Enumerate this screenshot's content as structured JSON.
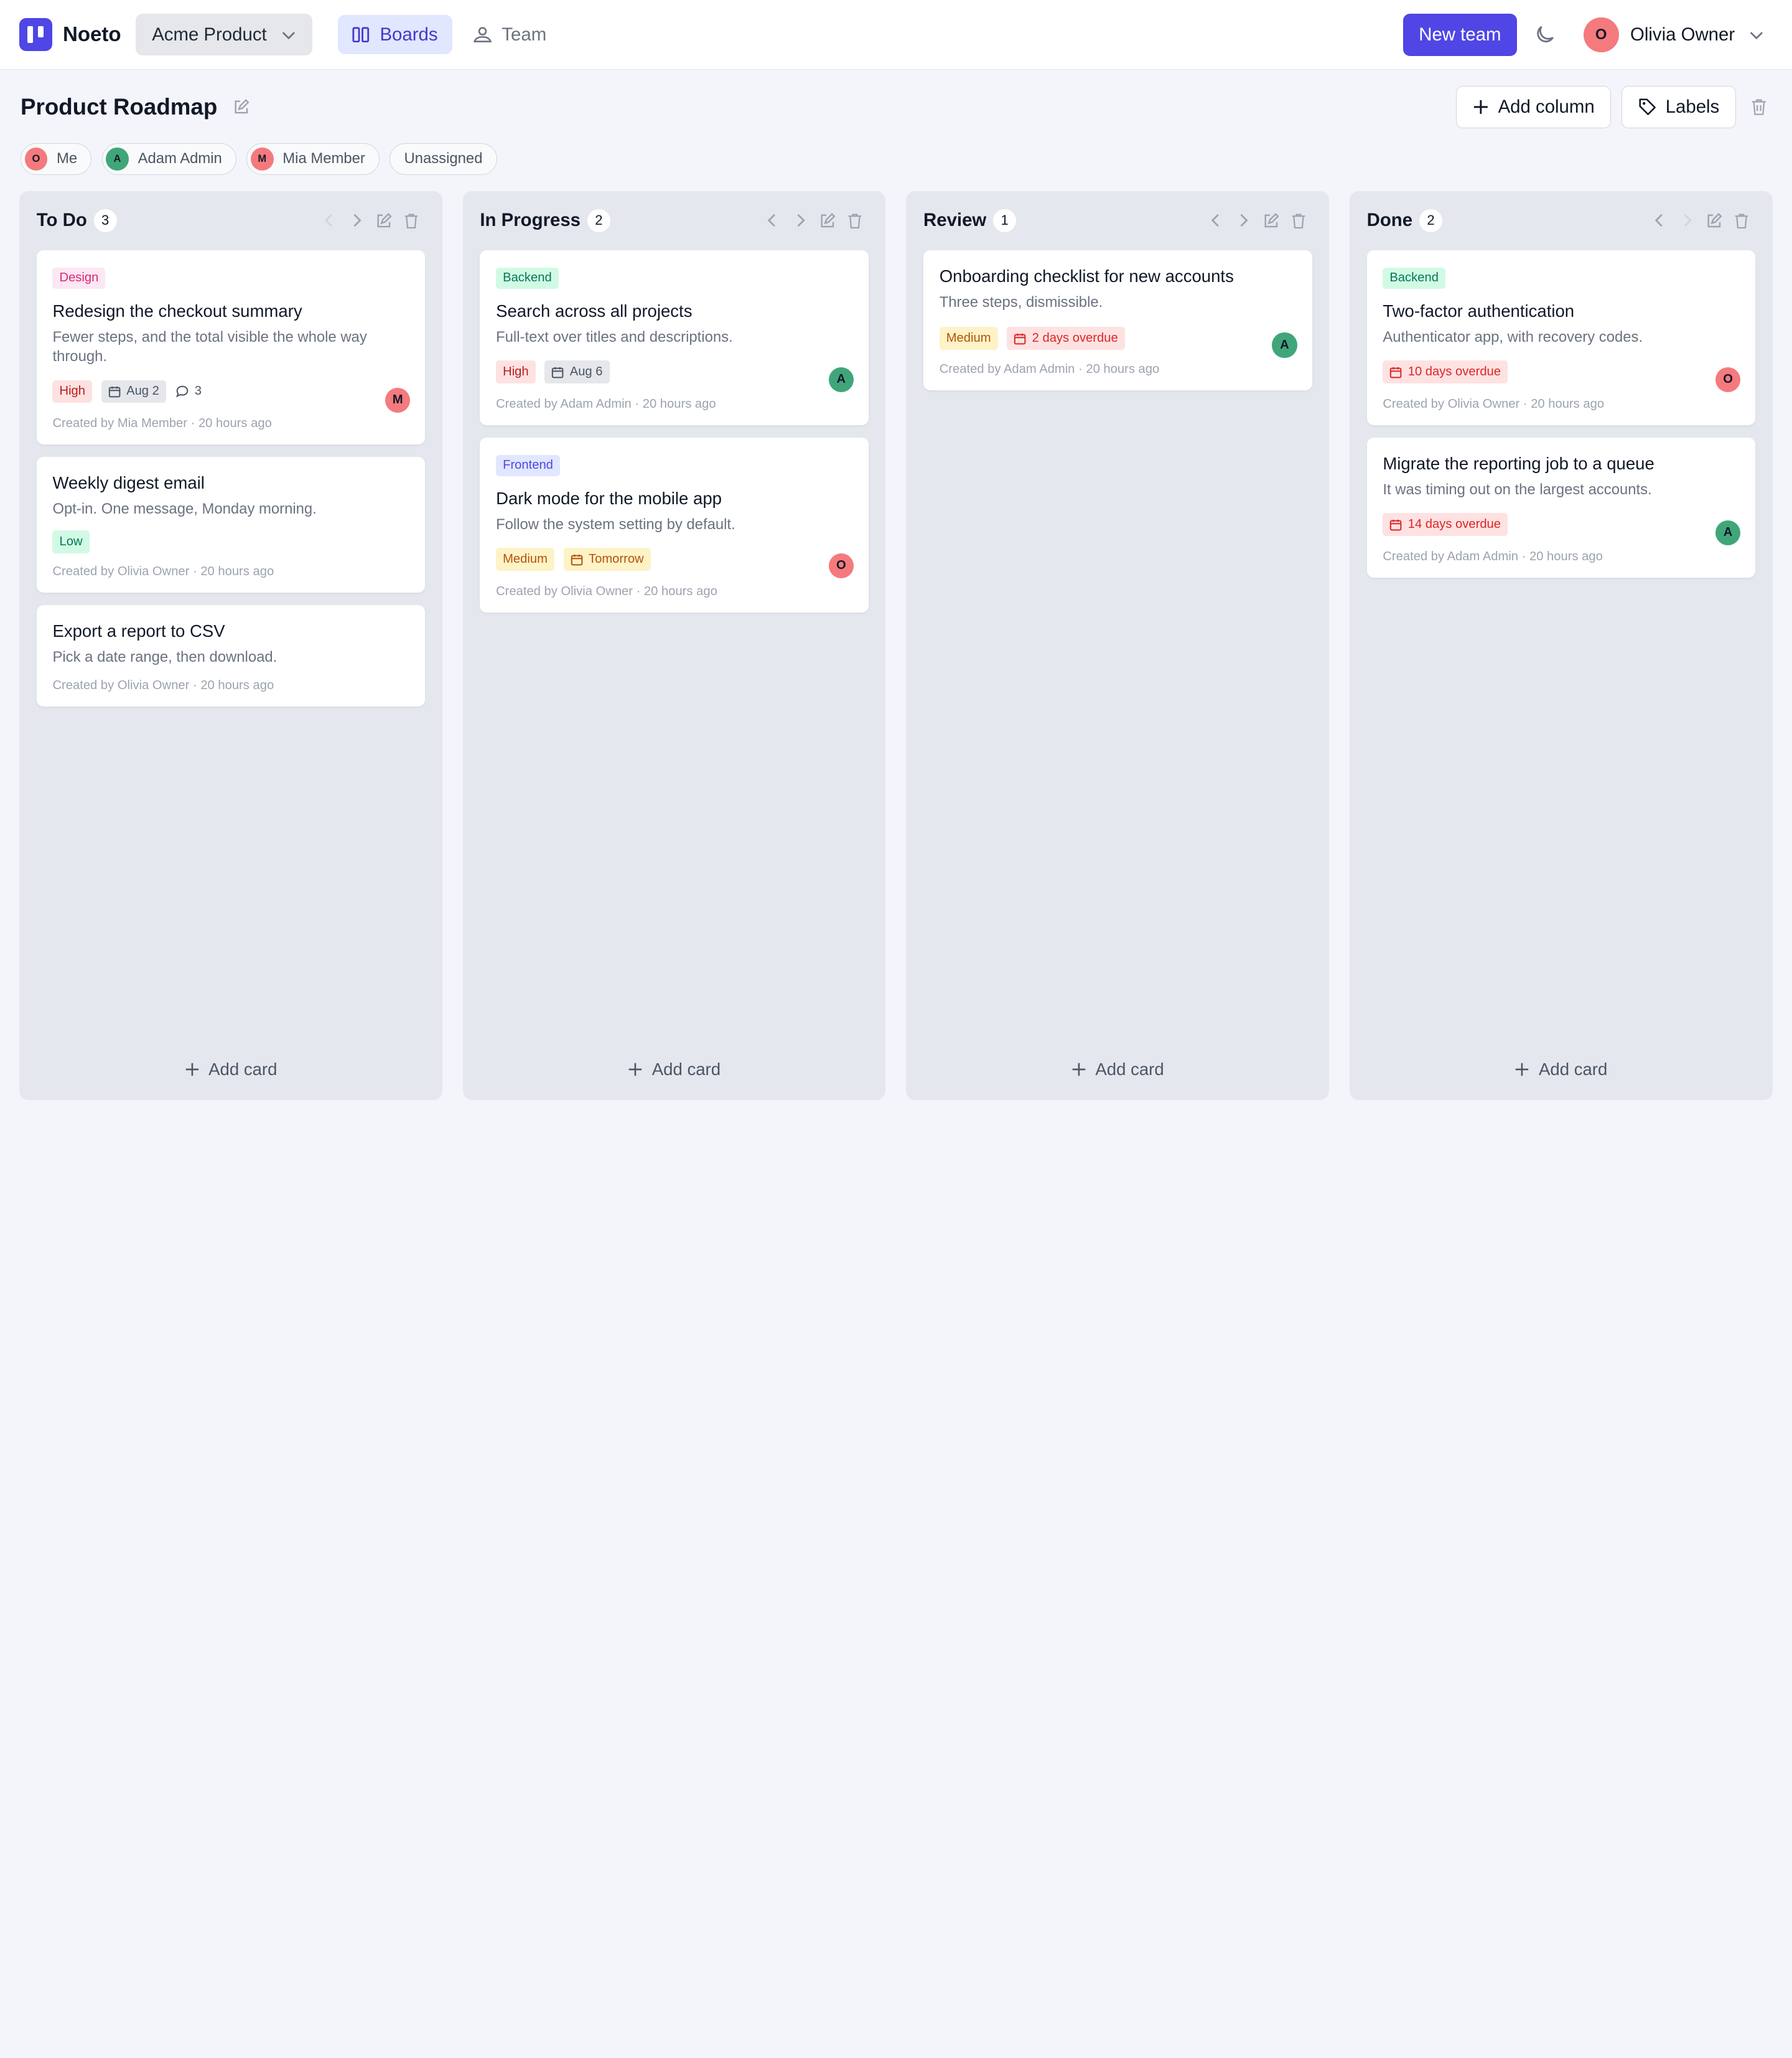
{
  "app": {
    "name": "Noeto",
    "workspace": "Acme Product"
  },
  "nav": {
    "boards": "Boards",
    "team": "Team"
  },
  "header": {
    "new_team": "New team",
    "user_initial": "O",
    "user_name": "Olivia Owner"
  },
  "board": {
    "title": "Product Roadmap",
    "add_column": "Add column",
    "labels": "Labels"
  },
  "filters": [
    {
      "initial": "O",
      "label": "Me",
      "color": "#f47a7e"
    },
    {
      "initial": "A",
      "label": "Adam Admin",
      "color": "#40a67a"
    },
    {
      "initial": "M",
      "label": "Mia Member",
      "color": "#f47a7e"
    },
    {
      "label": "Unassigned"
    }
  ],
  "add_card": "Add card",
  "columns": [
    {
      "title": "To Do",
      "count": "3",
      "cards": [
        {
          "label": "Design",
          "title": "Redesign the checkout summary",
          "desc": "Fewer steps, and the total visible the whole way through.",
          "priority": "High",
          "date": "Aug 2",
          "comments": "3",
          "assignee": "M",
          "created": "Created by Mia Member · 20 hours ago"
        },
        {
          "title": "Weekly digest email",
          "desc": "Opt-in. One message, Monday morning.",
          "priority": "Low",
          "created": "Created by Olivia Owner · 20 hours ago"
        },
        {
          "title": "Export a report to CSV",
          "desc": "Pick a date range, then download.",
          "created": "Created by Olivia Owner · 20 hours ago"
        }
      ]
    },
    {
      "title": "In Progress",
      "count": "2",
      "cards": [
        {
          "label": "Backend",
          "title": "Search across all projects",
          "desc": "Full-text over titles and descriptions.",
          "priority": "High",
          "date": "Aug 6",
          "assignee": "A",
          "created": "Created by Adam Admin · 20 hours ago"
        },
        {
          "label": "Frontend",
          "title": "Dark mode for the mobile app",
          "desc": "Follow the system setting by default.",
          "priority": "Medium",
          "due": "Tomorrow",
          "assignee": "O",
          "created": "Created by Olivia Owner · 20 hours ago"
        }
      ]
    },
    {
      "title": "Review",
      "count": "1",
      "cards": [
        {
          "title": "Onboarding checklist for new accounts",
          "desc": "Three steps, dismissible.",
          "priority": "Medium",
          "overdue": "2 days overdue",
          "assignee": "A",
          "created": "Created by Adam Admin · 20 hours ago"
        }
      ]
    },
    {
      "title": "Done",
      "count": "2",
      "cards": [
        {
          "label": "Backend",
          "title": "Two-factor authentication",
          "desc": "Authenticator app, with recovery codes.",
          "overdue": "10 days overdue",
          "assignee": "O",
          "created": "Created by Olivia Owner · 20 hours ago"
        },
        {
          "title": "Migrate the reporting job to a queue",
          "desc": "It was timing out on the largest accounts.",
          "overdue": "14 days overdue",
          "assignee": "A",
          "created": "Created by Adam Admin · 20 hours ago"
        }
      ]
    }
  ],
  "colors": {
    "accent": "#4f46e5",
    "avatar_red": "#f47a7e",
    "avatar_green": "#40a67a"
  }
}
